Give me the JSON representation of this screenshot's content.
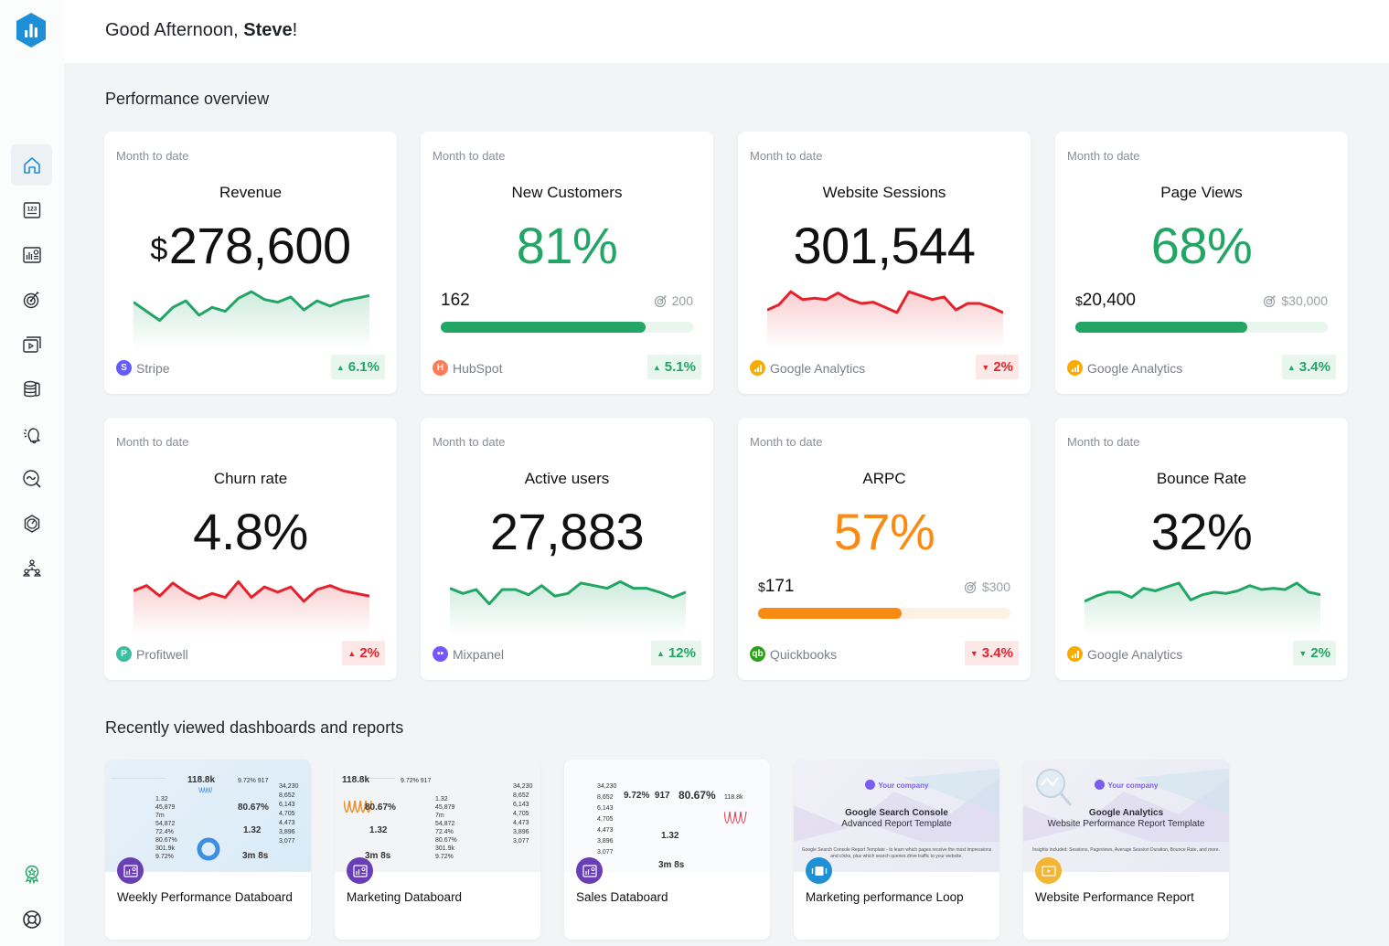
{
  "header": {
    "greeting_prefix": "Good Afternoon, ",
    "user_name": "Steve",
    "greeting_suffix": "!"
  },
  "sidebar": {
    "items": [
      {
        "icon": "home-icon",
        "label": "Home",
        "active": true
      },
      {
        "icon": "numbers-icon",
        "label": "Metrics"
      },
      {
        "icon": "databoard-icon",
        "label": "Databoards"
      },
      {
        "icon": "goal-icon",
        "label": "Goals"
      },
      {
        "icon": "presentation-icon",
        "label": "Loops"
      },
      {
        "icon": "database-icon",
        "label": "Data Sources"
      },
      {
        "icon": "bell-icon",
        "label": "Alerts"
      },
      {
        "icon": "insights-icon",
        "label": "Insights"
      },
      {
        "icon": "scorecard-icon",
        "label": "Scorecards"
      },
      {
        "icon": "team-icon",
        "label": "Team"
      }
    ],
    "bottom": [
      {
        "icon": "award-icon",
        "label": "Achievements"
      },
      {
        "icon": "help-icon",
        "label": "Help"
      }
    ]
  },
  "performance": {
    "title": "Performance overview",
    "cards": [
      {
        "period": "Month to date",
        "title": "Revenue",
        "currency": "$",
        "value": "278,600",
        "style": "dark",
        "chart": "spark",
        "trend": "up",
        "spark": [
          62,
          55,
          48,
          58,
          63,
          52,
          58,
          55,
          65,
          70,
          64,
          62,
          66,
          56,
          63,
          59,
          63,
          65,
          67
        ],
        "source": "Stripe",
        "source_color": "#635bff",
        "source_glyph": "S",
        "delta": "6.1%",
        "delta_dir": "up",
        "delta_good": true
      },
      {
        "period": "Month to date",
        "title": "New Customers",
        "value": "81%",
        "style": "green",
        "chart": "progress",
        "current": "162",
        "target": "200",
        "progress": 0.81,
        "bar_color": "#22a565",
        "track_color": "#e8f6ee",
        "source": "HubSpot",
        "source_color": "#ff7a59",
        "source_glyph": "H",
        "delta": "5.1%",
        "delta_dir": "up",
        "delta_good": true
      },
      {
        "period": "Month to date",
        "title": "Website Sessions",
        "value": "301,544",
        "style": "dark",
        "chart": "spark",
        "trend": "down",
        "spark": [
          56,
          60,
          70,
          64,
          65,
          64,
          69,
          64,
          61,
          62,
          58,
          54,
          70,
          67,
          64,
          66,
          56,
          61,
          61,
          58,
          54
        ],
        "source": "Google Analytics",
        "source_color": "#f9ab00",
        "source_glyph": "ga",
        "delta": "2%",
        "delta_dir": "down",
        "delta_good": false
      },
      {
        "period": "Month to date",
        "title": "Page Views",
        "value": "68%",
        "style": "green",
        "chart": "progress",
        "current_currency": "$",
        "current": "20,400",
        "target": "$30,000",
        "progress": 0.68,
        "bar_color": "#22a565",
        "track_color": "#e8f6ee",
        "source": "Google Analytics",
        "source_color": "#f9ab00",
        "source_glyph": "ga",
        "delta": "3.4%",
        "delta_dir": "up",
        "delta_good": true
      },
      {
        "period": "Month to date",
        "title": "Churn rate",
        "value": "4.8%",
        "style": "dark",
        "chart": "spark",
        "trend": "down",
        "spark": [
          60,
          64,
          56,
          66,
          59,
          54,
          58,
          55,
          67,
          55,
          63,
          59,
          63,
          52,
          61,
          64,
          60,
          58,
          56
        ],
        "source": "Profitwell",
        "source_color": "#3bbf9e",
        "source_glyph": "P",
        "delta": "2%",
        "delta_dir": "up",
        "delta_good": false
      },
      {
        "period": "Month to date",
        "title": "Active users",
        "value": "27,883",
        "style": "dark",
        "chart": "spark",
        "trend": "up",
        "spark": [
          62,
          58,
          61,
          50,
          61,
          61,
          57,
          64,
          56,
          58,
          66,
          64,
          62,
          67,
          62,
          62,
          59,
          55,
          59
        ],
        "source": "Mixpanel",
        "source_color": "#7856ff",
        "source_glyph": "••",
        "delta": "12%",
        "delta_dir": "up",
        "delta_good": true
      },
      {
        "period": "Month to date",
        "title": "ARPC",
        "value": "57%",
        "style": "orange",
        "chart": "progress",
        "current_currency": "$",
        "current": "171",
        "target": "$300",
        "progress": 0.57,
        "bar_color": "#f98a12",
        "track_color": "#fef1e4",
        "source": "Quickbooks",
        "source_color": "#2ca01c",
        "source_glyph": "qb",
        "delta": "3.4%",
        "delta_dir": "down",
        "delta_good": false
      },
      {
        "period": "Month to date",
        "title": "Bounce Rate",
        "value": "32%",
        "style": "dark",
        "chart": "spark",
        "trend": "up",
        "spark": [
          52,
          56,
          59,
          59,
          55,
          62,
          60,
          63,
          66,
          53,
          57,
          59,
          58,
          60,
          64,
          61,
          62,
          61,
          66,
          59,
          57
        ],
        "source": "Google Analytics",
        "source_color": "#f9ab00",
        "source_glyph": "ga",
        "delta": "2%",
        "delta_dir": "down",
        "delta_good": true
      }
    ]
  },
  "recent": {
    "title": "Recently viewed dashboards and reports",
    "items": [
      {
        "label": "Weekly Performance Databoard",
        "type": "databoard",
        "badge_color": "#6a3fb5",
        "thumb": "blue"
      },
      {
        "label": "Marketing Databoard",
        "type": "databoard",
        "badge_color": "#6a3fb5",
        "thumb": "gray"
      },
      {
        "label": "Sales Databoard",
        "type": "databoard",
        "badge_color": "#6a3fb5",
        "thumb": "white"
      },
      {
        "label": "Marketing performance Loop",
        "type": "loop",
        "badge_color": "#1f8fd6",
        "thumb": "purp",
        "template_company": "Your company",
        "template_title": "Google Search Console",
        "template_subtitle": "Advanced Report Template",
        "template_desc": "Google Search Console Report Template - to learn which pages receive the most impressions and clicks, plus which search queries drive traffic to your website."
      },
      {
        "label": "Website Performance Report",
        "type": "report",
        "badge_color": "#f2b534",
        "thumb": "purp",
        "template_company": "Your company",
        "template_title": "Google Analytics",
        "template_subtitle": "Website Performance Report Template",
        "template_desc": "Insights included: Sessions, Pageviews, Average Session Duration, Bounce Rate, and more."
      }
    ],
    "thumb_stats": {
      "sessions": "118.8k",
      "pct_a": "9.72%",
      "count": "917",
      "pct_b": "80.67%",
      "ratio": "1.32",
      "duration": "3m 8s",
      "table": [
        "34,230",
        "8,652",
        "6,143",
        "4,705",
        "4,473",
        "3,896",
        "3,077"
      ]
    }
  },
  "colors": {
    "green": "#22a565",
    "red": "#e5222b",
    "orange": "#f98a12",
    "brand": "#1c8fd6"
  }
}
